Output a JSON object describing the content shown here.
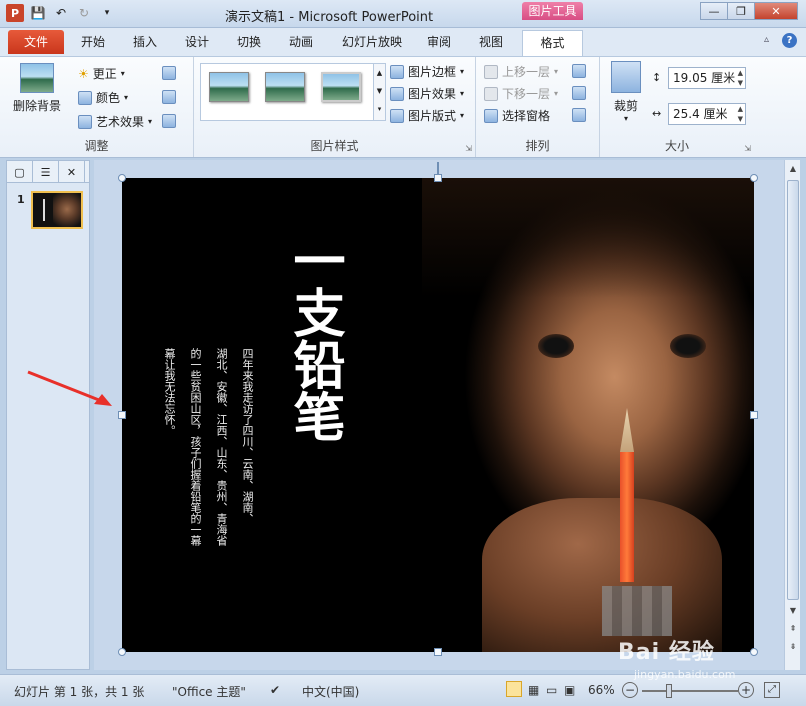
{
  "window": {
    "title": "演示文稿1 - Microsoft PowerPoint",
    "context_tab": "图片工具",
    "minimize": "—",
    "restore": "❐",
    "close": "✕"
  },
  "tabs": [
    {
      "label": "文件"
    },
    {
      "label": "开始"
    },
    {
      "label": "插入"
    },
    {
      "label": "设计"
    },
    {
      "label": "切换"
    },
    {
      "label": "动画"
    },
    {
      "label": "幻灯片放映"
    },
    {
      "label": "审阅"
    },
    {
      "label": "视图"
    },
    {
      "label": "格式"
    }
  ],
  "ribbon": {
    "adjust": {
      "group_label": "调整",
      "remove_bg": "删除背景",
      "corrections": "更正",
      "color": "颜色",
      "art_effects": "艺术效果"
    },
    "styles": {
      "group_label": "图片样式",
      "border": "图片边框",
      "effects": "图片效果",
      "layout": "图片版式"
    },
    "arrange": {
      "group_label": "排列",
      "bring_forward": "上移一层",
      "send_backward": "下移一层",
      "selection_pane": "选择窗格"
    },
    "size": {
      "group_label": "大小",
      "crop": "裁剪",
      "height": "19.05 厘米",
      "width": "25.4 厘米"
    }
  },
  "slides_pane": {
    "slide_number": "1"
  },
  "slide": {
    "title_text": "一支铅笔",
    "poem_lines": [
      "四年来我走访了四川、云南、湖南、",
      "湖北、安徽、江西、山东、贵州、青海省",
      "的一些贫困山区，孩子们握着铅笔的一幕",
      "幕让我无法忘怀。"
    ]
  },
  "statusbar": {
    "slide_info": "幻灯片 第 1 张，共 1 张",
    "theme": "\"Office 主题\"",
    "language": "中文(中国)",
    "zoom": "66%"
  },
  "watermark": {
    "logo": "Bai 经验",
    "url": "jingyan.baidu.com"
  }
}
